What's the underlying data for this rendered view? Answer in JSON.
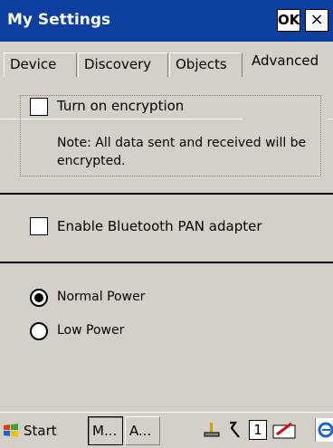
{
  "window": {
    "title": "My Settings",
    "ok_label": "OK",
    "close_label": "×"
  },
  "tabs": [
    {
      "label": "Device"
    },
    {
      "label": "Discovery"
    },
    {
      "label": "Objects"
    },
    {
      "label": "Advanced",
      "active": true
    }
  ],
  "settings": {
    "encryption_label": "Turn on encryption",
    "encryption_checked": false,
    "encryption_note": "Note: All data sent and received will be encrypted.",
    "pan_label": "Enable Bluetooth PAN adapter",
    "pan_checked": false,
    "power_options": [
      {
        "label": "Normal Power",
        "selected": true
      },
      {
        "label": "Low Power",
        "selected": false
      }
    ]
  },
  "taskbar": {
    "start_label": "Start",
    "tasks": [
      {
        "label": "M..."
      },
      {
        "label": "A..."
      }
    ],
    "tray_number": "1",
    "icons": [
      "windows-flag-icon",
      "network-icon",
      "bluetooth-icon",
      "ime-icon",
      "input-panel-icon",
      "ie-icon"
    ]
  },
  "colors": {
    "title_bar": "#0b3fa0",
    "background": "#d4d0c8"
  }
}
